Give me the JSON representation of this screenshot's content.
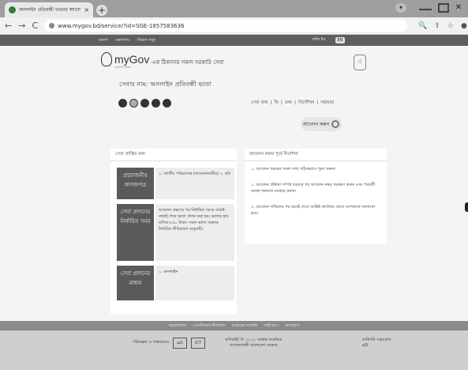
{
  "browser": {
    "tab_title": "অনলাইন প্রতিবন্ধী ভাতার আবেদন",
    "tab_close": "×",
    "new_tab": "+",
    "url": "www.mygov.bd/service/?id=SGE-1857583636",
    "nav_back": "←",
    "nav_forward": "→",
    "nav_reload": "C"
  },
  "gov_strip": {
    "left_items": [
      "বাংলা",
      "মন্ত্রণালয়",
      "বিভাগ সমূহ"
    ],
    "right_text": "সাইন ইন",
    "lang": "EN"
  },
  "brand": {
    "logo_text": "myGov",
    "logo_sub": "বাংলাদেশ সরকার",
    "tagline": "এক ঠিকানায় সকল সরকারি সেবা"
  },
  "service": {
    "title": "সেবার নাম: অনলাইন প্রতিবন্ধী ভাতা",
    "toplinks": [
      "সেবা তথ্য",
      "ফি",
      "তথ্য",
      "নির্দেশিকা",
      "সহায়তা"
    ],
    "apply_label": "আবেদন করুন"
  },
  "left_panel": {
    "header": "সেবা প্রাপ্তির তথ্য",
    "blocks": [
      {
        "label": "প্রয়োজনীয় কাগজপত্র",
        "value": "১. জাতীয় পরিচয়পত্র (আবেদনকারীর) ২. ছবি"
      },
      {
        "label": "সেবা প্রদানের নির্ধারিত সময়",
        "value": "আবেদন গ্রহণের পর নির্ধারিত সময়ে যাচাই-বাছাই শেষে ভাতা প্রদান করা হয়। ভাতার হার মাসিক ৮৫০ টাকা। সকল ভাতা সরকার নির্ধারিত নীতিমালা অনুযায়ী।"
      },
      {
        "label": "সেবা প্রদানের মাধ্যম",
        "value": "১. অনলাইন"
      }
    ]
  },
  "right_panel": {
    "header": "আবেদন করার পূর্বে নির্দেশনা",
    "paragraphs": [
      "১. আবেদন ফরমের সকল তথ্য সঠিকভাবে পূরণ করুন।",
      "২. আবেদন প্রক্রিয়া সম্পন্ন হওয়ার পর আবেদন নম্বর সংরক্ষণ করুন এবং পরবর্তী অবস্থা জানতে ব্যবহার করুন।",
      "৩. আবেদন দাখিলের পর যাচাই শেষে সংশ্লিষ্ট কার্যালয় থেকে আপনাকে জানানো হবে।"
    ]
  },
  "footer": {
    "links": [
      "সহযোগিতায়",
      "গোপনীয়তার নীতিমালা",
      "ব্যবহারের শর্তাবলি",
      "সাইট ম্যাপ",
      "যোগাযোগ"
    ],
    "partners_label": "পরিকল্পনা ও বাস্তবায়নে",
    "badges": [
      "a2i",
      "ICT"
    ],
    "mid_line1": "কপিরাইট © ২০২২ সর্বস্বত্ব সংরক্ষিত",
    "mid_line2": "গণপ্রজাতন্ত্রী বাংলাদেশ সরকার",
    "right_line1": "কারিগরি সহায়তায়",
    "right_line2": "a2i"
  }
}
